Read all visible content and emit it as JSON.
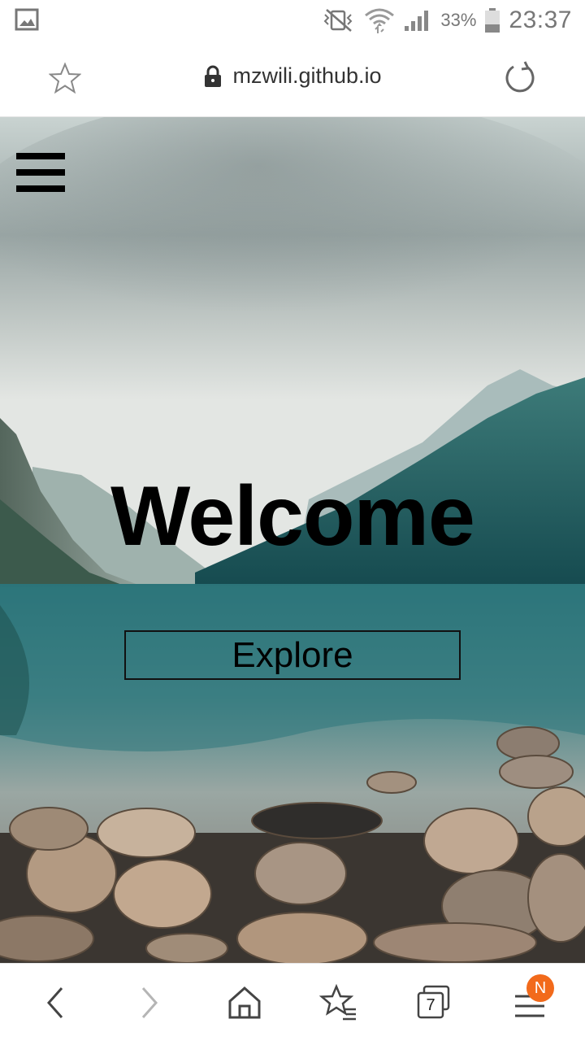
{
  "status_bar": {
    "battery_percent": "33%",
    "time": "23:37",
    "icons": [
      "image-icon",
      "vibrate-mute-icon",
      "wifi-icon",
      "signal-icon",
      "battery-icon"
    ]
  },
  "browser": {
    "url": "mzwili.github.io",
    "icons": [
      "bookmark-star-icon",
      "lock-icon",
      "reload-icon"
    ]
  },
  "page": {
    "title": "Welcome",
    "cta_label": "Explore",
    "icons": [
      "hamburger-menu-icon"
    ]
  },
  "bottom_nav": {
    "tabs_count": "7",
    "badge_text": "N",
    "icons": [
      "back-icon",
      "forward-icon",
      "home-icon",
      "bookmarks-icon",
      "tabs-icon",
      "menu-icon"
    ],
    "colors": {
      "badge": "#f26a1b",
      "forward_disabled": "#b5b5b5"
    }
  }
}
